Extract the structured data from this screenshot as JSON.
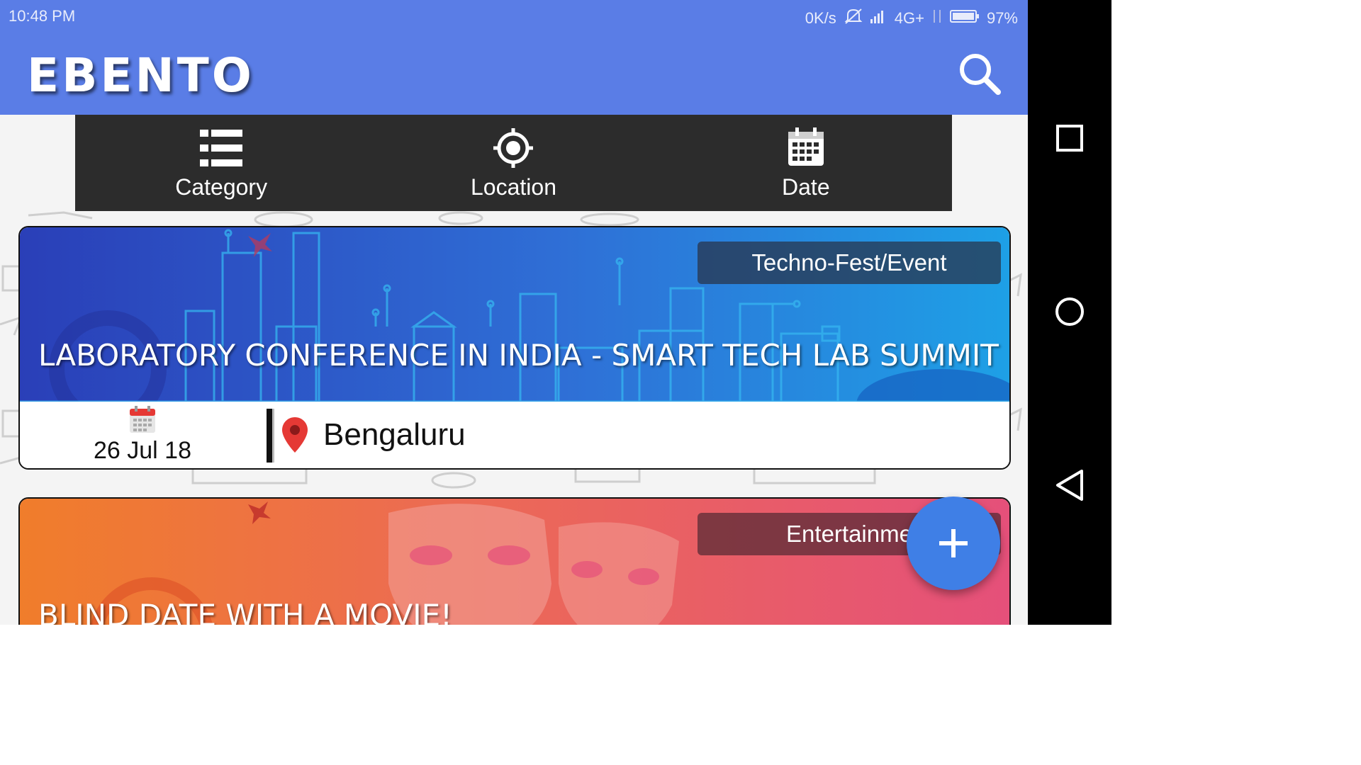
{
  "status_bar": {
    "time": "10:48 PM",
    "network_speed": "0K/s",
    "network_type": "4G+",
    "battery": "97%"
  },
  "app_bar": {
    "title": "EBENTO",
    "search_icon": "search-icon"
  },
  "filters": [
    {
      "label": "Category",
      "icon": "list-icon"
    },
    {
      "label": "Location",
      "icon": "target-icon"
    },
    {
      "label": "Date",
      "icon": "calendar-icon"
    }
  ],
  "events": [
    {
      "category": "Techno-Fest/Event",
      "title": "LABORATORY CONFERENCE IN INDIA - SMART TECH LAB SUMMIT",
      "date": "26 Jul 18",
      "location": "Bengaluru",
      "banner_colors": [
        "#2a3fb8",
        "#1ea0e6"
      ]
    },
    {
      "category": "Entertainme",
      "title": "BLIND DATE WITH A MOVIE!",
      "banner_colors": [
        "#f07d2b",
        "#e5507a"
      ]
    }
  ],
  "fab": {
    "icon": "plus-icon"
  },
  "colors": {
    "primary": "#5a7de6",
    "filter_bar": "#2c2c2c",
    "fab": "#3f7fe6",
    "pin": "#e53935"
  }
}
